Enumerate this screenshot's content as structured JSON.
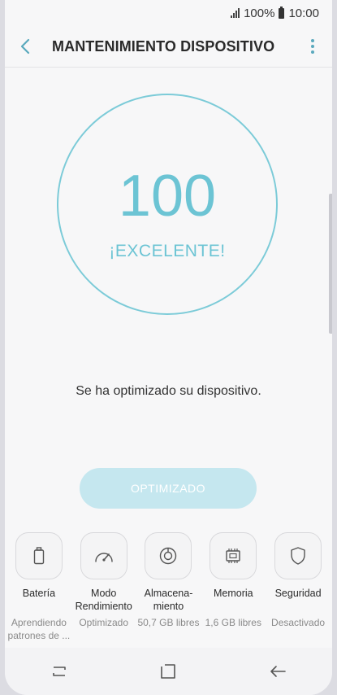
{
  "status_bar": {
    "battery_percent": "100%",
    "time": "10:00"
  },
  "header": {
    "title": "MANTENIMIENTO DISPOSITIVO",
    "back_icon": "back-arrow-icon",
    "menu_icon": "more-vertical-icon"
  },
  "score": {
    "value": "100",
    "label": "¡EXCELENTE!",
    "ring_color": "#7ccbd8",
    "text_color": "#6cc4d4"
  },
  "message": "Se ha optimizado su dispositivo.",
  "optimize_button": {
    "label": "OPTIMIZADO",
    "color": "#c5e7ef"
  },
  "tiles": [
    {
      "icon": "battery-icon",
      "label": "Batería",
      "sub": "Aprendiendo\npatrones de ..."
    },
    {
      "icon": "speedometer-icon",
      "label": "Modo\nRendimiento",
      "sub": "Optimizado"
    },
    {
      "icon": "storage-icon",
      "label": "Almacena-\nmiento",
      "sub": "50,7 GB libres"
    },
    {
      "icon": "memory-chip-icon",
      "label": "Memoria",
      "sub": "1,6 GB libres"
    },
    {
      "icon": "shield-icon",
      "label": "Seguridad",
      "sub": "Desactivado"
    }
  ],
  "nav": {
    "recents_icon": "recents-icon",
    "home_icon": "home-icon",
    "back_icon": "back-icon"
  }
}
